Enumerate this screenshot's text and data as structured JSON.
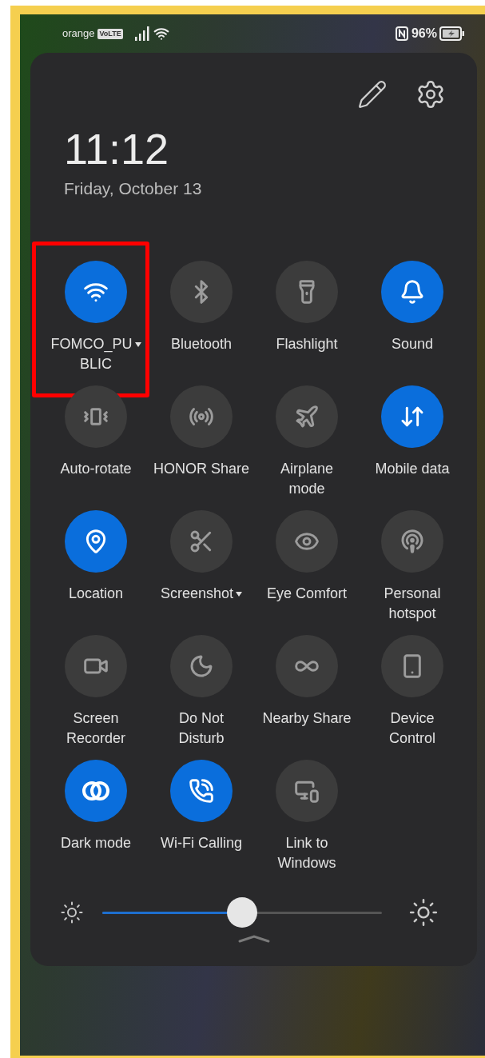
{
  "status_bar": {
    "carrier": "orange",
    "network_badge": "VoLTE",
    "battery_percent": "96%"
  },
  "header": {
    "time": "11:12",
    "date": "Friday, October 13"
  },
  "tiles": [
    {
      "lines": [
        "FOMCO_PU",
        "BLIC"
      ],
      "on": true,
      "dropdown": true,
      "highlighted": true
    },
    {
      "lines": [
        "Bluetooth"
      ],
      "on": false,
      "dropdown": false,
      "highlighted": false
    },
    {
      "lines": [
        "Flashlight"
      ],
      "on": false,
      "dropdown": false,
      "highlighted": false
    },
    {
      "lines": [
        "Sound"
      ],
      "on": true,
      "dropdown": false,
      "highlighted": false
    },
    {
      "lines": [
        "Auto-rotate"
      ],
      "on": false,
      "dropdown": false,
      "highlighted": false
    },
    {
      "lines": [
        "HONOR Share"
      ],
      "on": false,
      "dropdown": false,
      "highlighted": false
    },
    {
      "lines": [
        "Airplane",
        "mode"
      ],
      "on": false,
      "dropdown": false,
      "highlighted": false
    },
    {
      "lines": [
        "Mobile data"
      ],
      "on": true,
      "dropdown": false,
      "highlighted": false
    },
    {
      "lines": [
        "Location"
      ],
      "on": true,
      "dropdown": false,
      "highlighted": false
    },
    {
      "lines": [
        "Screenshot"
      ],
      "on": false,
      "dropdown": true,
      "highlighted": false
    },
    {
      "lines": [
        "Eye Comfort"
      ],
      "on": false,
      "dropdown": false,
      "highlighted": false
    },
    {
      "lines": [
        "Personal",
        "hotspot"
      ],
      "on": false,
      "dropdown": false,
      "highlighted": false
    },
    {
      "lines": [
        "Screen",
        "Recorder"
      ],
      "on": false,
      "dropdown": false,
      "highlighted": false
    },
    {
      "lines": [
        "Do Not",
        "Disturb"
      ],
      "on": false,
      "dropdown": false,
      "highlighted": false
    },
    {
      "lines": [
        "Nearby Share"
      ],
      "on": false,
      "dropdown": false,
      "highlighted": false
    },
    {
      "lines": [
        "Device",
        "Control"
      ],
      "on": false,
      "dropdown": false,
      "highlighted": false
    },
    {
      "lines": [
        "Dark mode"
      ],
      "on": true,
      "dropdown": false,
      "highlighted": false
    },
    {
      "lines": [
        "Wi-Fi Calling"
      ],
      "on": true,
      "dropdown": false,
      "highlighted": false
    },
    {
      "lines": [
        "Link to",
        "Windows"
      ],
      "on": false,
      "dropdown": false,
      "highlighted": false
    }
  ],
  "brightness": {
    "level": 0.5
  }
}
